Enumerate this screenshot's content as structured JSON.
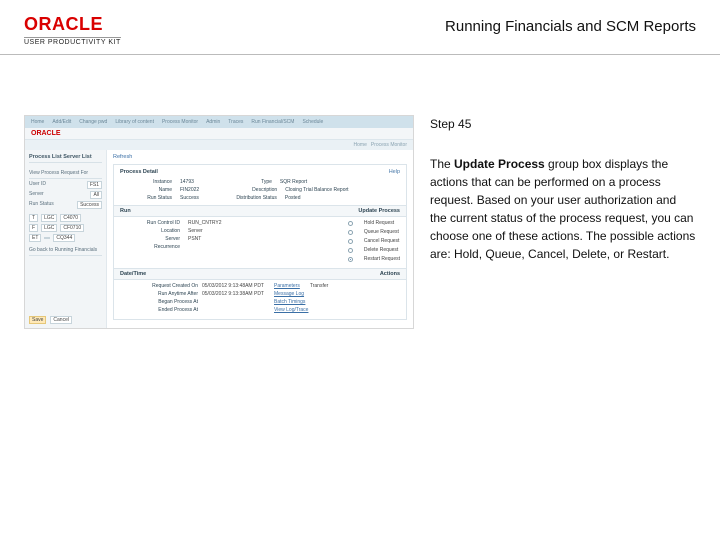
{
  "header": {
    "logo_text": "ORACLE",
    "logo_subtext": "USER PRODUCTIVITY KIT",
    "doc_title": "Running Financials and SCM Reports"
  },
  "right": {
    "step_label": "Step 45",
    "p_before_bold": "The ",
    "p_bold": "Update Process",
    "p_after_bold": " group box displays the actions that can be performed on a process request. Based on your user authorization and the current status of the process request, you can choose one of these actions. The possible actions are: Hold, Queue, Cancel, Delete, or Restart."
  },
  "mock": {
    "topnav": [
      "Home",
      "Add/Edit",
      "Change pwd",
      "Library of content",
      "Process Monitor",
      "Admin",
      "Traces",
      "Run Financial/SCM",
      "Schedule"
    ],
    "brand": "ORACLE",
    "bread": [
      "Home",
      "Process Monitor"
    ],
    "side": {
      "tabs": "Process List    Server List",
      "view_label": "View Process Request For",
      "rows": [
        {
          "k": "User ID",
          "v": "FS1"
        },
        {
          "k": "Server",
          "v": "All"
        },
        {
          "k": "Run Status",
          "v": "Success"
        }
      ],
      "list": [
        {
          "c1": "T",
          "c2": "LGC",
          "c3": "C4070"
        },
        {
          "c1": "F",
          "c2": "LGC",
          "c3": "CF0710"
        },
        {
          "c1": "ET",
          "c2": "",
          "c3": "CQ344"
        },
        {
          "c1": "",
          "c2": "",
          "c3": ""
        }
      ],
      "tip": "Go back to Running Financials",
      "save": "Save",
      "cancel": "Cancel"
    },
    "main": {
      "refresh": "Refresh",
      "pd_title": "Process Detail",
      "pd_help": "Help",
      "process_rows": [
        {
          "lbl": "Instance",
          "val": "14793",
          "lbl2": "Type",
          "val2": "SQR Report"
        },
        {
          "lbl": "Name",
          "val": "FIN2022",
          "lbl2": "Description",
          "val2": "Closing Trial Balance Report"
        },
        {
          "lbl": "Run Status",
          "val": "Success",
          "lbl2": "Distribution Status",
          "val2": "Posted"
        }
      ],
      "sec_run": "Run",
      "sec_update": "Update Process",
      "run_rows": [
        {
          "lbl": "Run Control ID",
          "val": "RUN_CNTRY2"
        },
        {
          "lbl": "Location",
          "val": "Server"
        },
        {
          "lbl": "Server",
          "val": "PSNT"
        },
        {
          "lbl": "Recurrence",
          "val": ""
        }
      ],
      "update_options": [
        {
          "label": "Hold Request",
          "on": false
        },
        {
          "label": "Queue Request",
          "on": false
        },
        {
          "label": "Cancel Request",
          "on": false
        },
        {
          "label": "Delete Request",
          "on": false
        },
        {
          "label": "Restart Request",
          "on": true
        }
      ],
      "sec_datetime": "Date/Time",
      "sec_actions": "Actions",
      "datetime_rows": [
        {
          "k": "Request Created On",
          "v": "05/03/2012 9:13:48AM PDT"
        },
        {
          "k": "Run Anytime After",
          "v": "05/03/2012 9:13:38AM PDT"
        },
        {
          "k": "Began Process At",
          "v": ""
        },
        {
          "k": "Ended Process At",
          "v": ""
        }
      ],
      "actions": [
        "Parameters",
        "Message Log",
        "Batch Timings",
        "View Log/Trace"
      ],
      "action_extra": "Transfer"
    }
  }
}
